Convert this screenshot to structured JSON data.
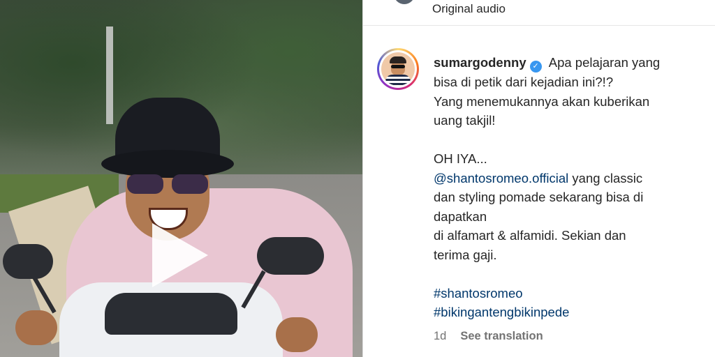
{
  "audio": {
    "label": "Original audio"
  },
  "post": {
    "username": "sumargodenny",
    "caption_intro": " Apa pelajaran yang",
    "caption_lines": [
      "bisa di petik dari kejadian ini?!?",
      "Yang menemukannya akan kuberikan",
      "uang takjil!",
      "",
      "OH IYA..."
    ],
    "mention": "@shantosromeo.official",
    "mention_suffix": " yang classic",
    "caption_lines_2": [
      "dan styling pomade sekarang bisa di",
      "dapatkan",
      "di alfamart & alfamidi. Sekian dan",
      "terima gaji.",
      ""
    ],
    "hashtags": [
      "#shantosromeo",
      "#bikingantengbikinpede"
    ],
    "time": "1d",
    "see_translation": "See translation"
  },
  "icons": {
    "verified": "verified-badge-icon",
    "play": "play-icon"
  },
  "colors": {
    "link": "#00376b",
    "verified": "#3897f0",
    "muted": "#737373"
  }
}
